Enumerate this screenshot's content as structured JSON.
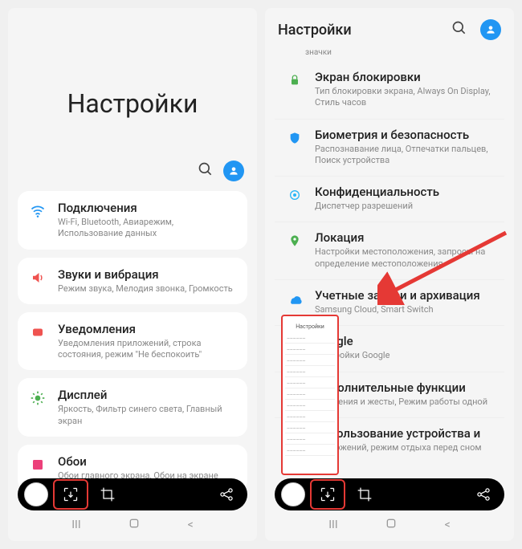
{
  "left": {
    "bigTitle": "Настройки",
    "items": [
      {
        "title": "Подключения",
        "sub": "Wi-Fi, Bluetooth, Авиарежим, Использование данных",
        "iconColor": "#2196f3"
      },
      {
        "title": "Звуки и вибрация",
        "sub": "Режим звука, Мелодия звонка, Громкость",
        "iconColor": "#ef5350"
      },
      {
        "title": "Уведомления",
        "sub": "Уведомления приложений, строка состояния, режим \"Не беспокоить\"",
        "iconColor": "#ef5350"
      },
      {
        "title": "Дисплей",
        "sub": "Яркость, Фильтр синего света, Главный экран",
        "iconColor": "#4caf50"
      },
      {
        "title": "Обои",
        "sub": "Обои главного экрана, Обои на экране",
        "iconColor": "#ec407a"
      }
    ]
  },
  "right": {
    "headerTitle": "Настройки",
    "prevSub": "значки",
    "items": [
      {
        "title": "Экран блокировки",
        "sub": "Тип блокировки экрана, Always On Display, Стиль часов",
        "iconColor": "#4caf50"
      },
      {
        "title": "Биометрия и безопасность",
        "sub": "Распознавание лица, Отпечатки пальцев, Поиск устройства",
        "iconColor": "#2196f3"
      },
      {
        "title": "Конфиденциальность",
        "sub": "Диспетчер разрешений",
        "iconColor": "#29b6f6"
      },
      {
        "title": "Локация",
        "sub": "Настройки местоположения, запросы на определение местоположения",
        "iconColor": "#4caf50"
      },
      {
        "title": "Учетные записи и архивация",
        "sub": "Samsung Cloud, Smart Switch",
        "iconColor": "#2196f3"
      },
      {
        "title": "Google",
        "sub": "Настройки Google",
        "iconColor": "#888"
      },
      {
        "title": "Дополнительные функции",
        "sub": "Движения и жесты, Режим работы одной",
        "iconColor": "#ff9800"
      },
      {
        "title": "Использование устройства и",
        "sub": "приложений, режим отдыха перед сном",
        "iconColor": "#4caf50"
      }
    ]
  },
  "scrollPreview": {
    "title": "Настройки"
  },
  "nav": {
    "recent": "III",
    "home": "○",
    "back": "<"
  }
}
